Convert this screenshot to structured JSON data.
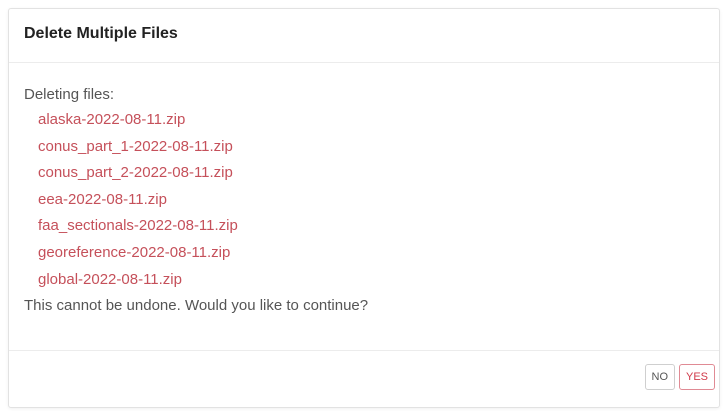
{
  "dialog": {
    "title": "Delete Multiple Files",
    "intro": "Deleting files:",
    "files": [
      "alaska-2022-08-11.zip",
      "conus_part_1-2022-08-11.zip",
      "conus_part_2-2022-08-11.zip",
      "eea-2022-08-11.zip",
      "faa_sectionals-2022-08-11.zip",
      "georeference-2022-08-11.zip",
      "global-2022-08-11.zip"
    ],
    "warning": "This cannot be undone. Would you like to continue?",
    "no_label": "NO",
    "yes_label": "YES"
  },
  "colors": {
    "file_text": "#c5505a",
    "yes_text": "#d03a4a",
    "body_text": "#555555"
  }
}
